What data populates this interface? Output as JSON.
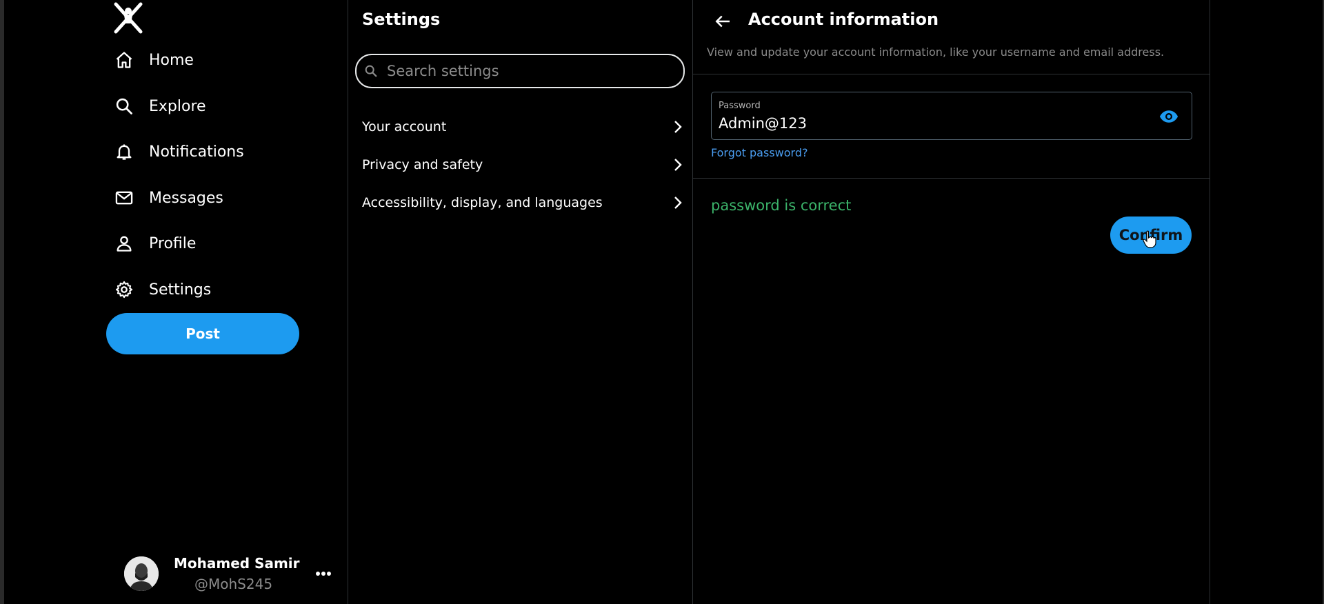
{
  "nav": {
    "logo_icon": "x-logo-icon",
    "items": [
      {
        "label": "Home",
        "icon": "home-icon"
      },
      {
        "label": "Explore",
        "icon": "search-icon"
      },
      {
        "label": "Notifications",
        "icon": "bell-icon"
      },
      {
        "label": "Messages",
        "icon": "mail-icon"
      },
      {
        "label": "Profile",
        "icon": "person-icon"
      },
      {
        "label": "Settings",
        "icon": "gear-icon"
      }
    ],
    "post_label": "Post",
    "profile": {
      "name": "Mohamed Samir",
      "handle": "@MohS245"
    }
  },
  "settings": {
    "title": "Settings",
    "search_placeholder": "Search settings",
    "items": [
      {
        "label": "Your account"
      },
      {
        "label": "Privacy and safety"
      },
      {
        "label": "Accessibility, display, and languages"
      }
    ]
  },
  "account": {
    "title": "Account information",
    "subtitle": "View and update your account information, like your username and email address.",
    "password_label": "Password",
    "password_value": "Admin@123",
    "forgot_label": "Forgot password?",
    "status_text": "password is correct",
    "confirm_label": "Confirm"
  },
  "colors": {
    "accent": "#1d9bf0",
    "status_success": "#3bb36a",
    "link": "#4a9df0",
    "background": "#000000"
  }
}
